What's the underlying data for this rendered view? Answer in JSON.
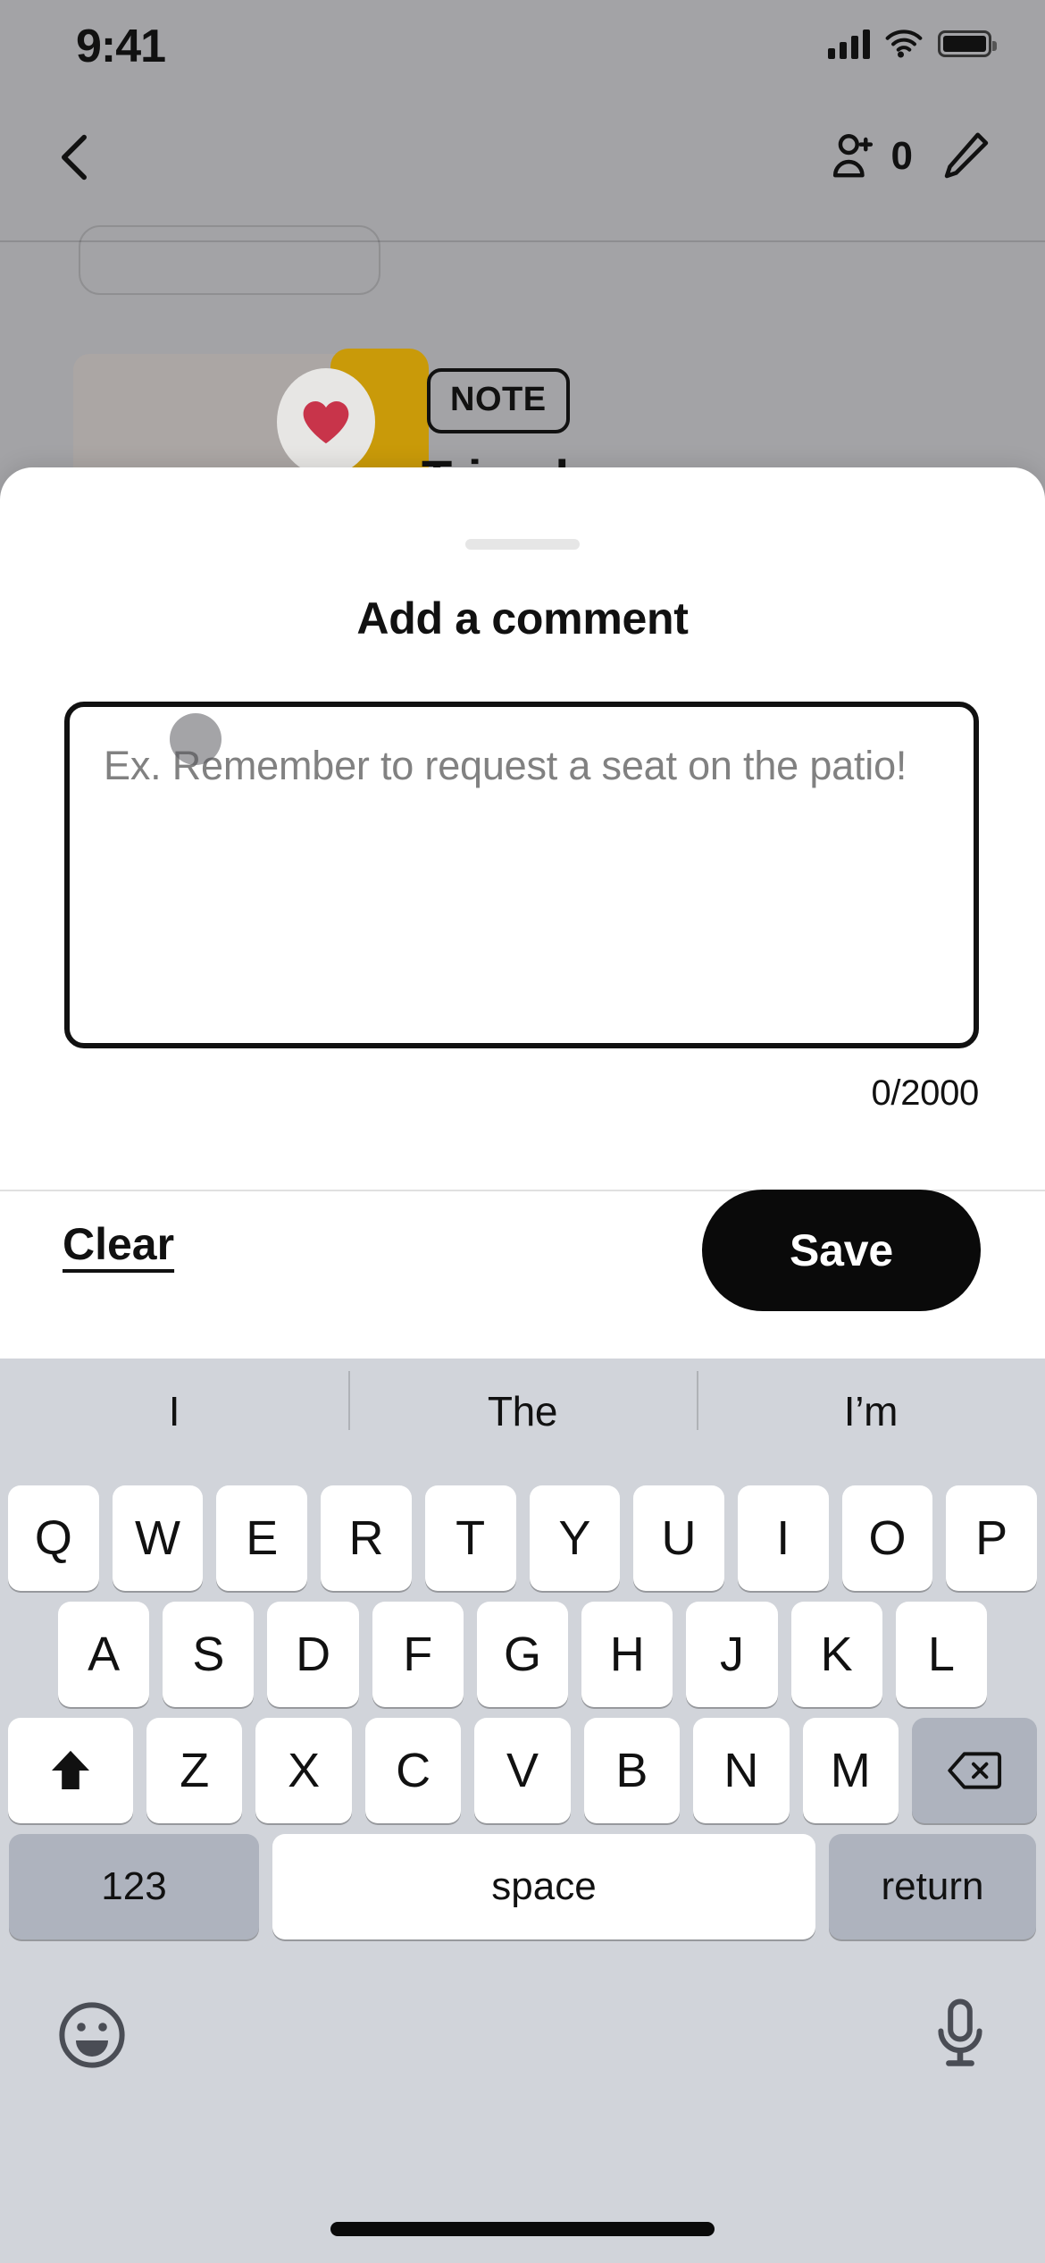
{
  "status_bar": {
    "time": "9:41",
    "signal_icon": "cellular-signal-icon",
    "wifi_icon": "wifi-icon",
    "battery_icon": "battery-icon"
  },
  "nav_bar": {
    "back_icon": "back-chevron-icon",
    "add_person_icon": "add-person-icon",
    "collaborator_count": "0",
    "edit_icon": "pencil-edit-icon"
  },
  "background_card": {
    "heart_icon": "heart-icon",
    "badge_label": "NOTE",
    "title": "Trip plan",
    "accent_color": "#c99a09",
    "heart_color": "#c8344a"
  },
  "sheet": {
    "grabber": "drag-handle",
    "title": "Add a comment",
    "comment_input": {
      "value": "",
      "placeholder": "Ex. Remember to request a seat on the patio!"
    },
    "char_counter": "0/2000",
    "clear_label": "Clear",
    "save_label": "Save",
    "save_bg": "#0a0a0a"
  },
  "keyboard": {
    "suggestions": [
      "I",
      "The",
      "I’m"
    ],
    "row1": [
      "Q",
      "W",
      "E",
      "R",
      "T",
      "Y",
      "U",
      "I",
      "O",
      "P"
    ],
    "row2": [
      "A",
      "S",
      "D",
      "F",
      "G",
      "H",
      "J",
      "K",
      "L"
    ],
    "row3": [
      "Z",
      "X",
      "C",
      "V",
      "B",
      "N",
      "M"
    ],
    "shift_icon": "shift-arrow-icon",
    "backspace_icon": "backspace-delete-icon",
    "numeric_label": "123",
    "space_label": "space",
    "return_label": "return",
    "emoji_icon": "emoji-smiley-icon",
    "mic_icon": "microphone-icon",
    "key_bg": "#ffffff",
    "modifier_bg": "#aeb3be",
    "keyboard_bg": "#d1d4da"
  }
}
